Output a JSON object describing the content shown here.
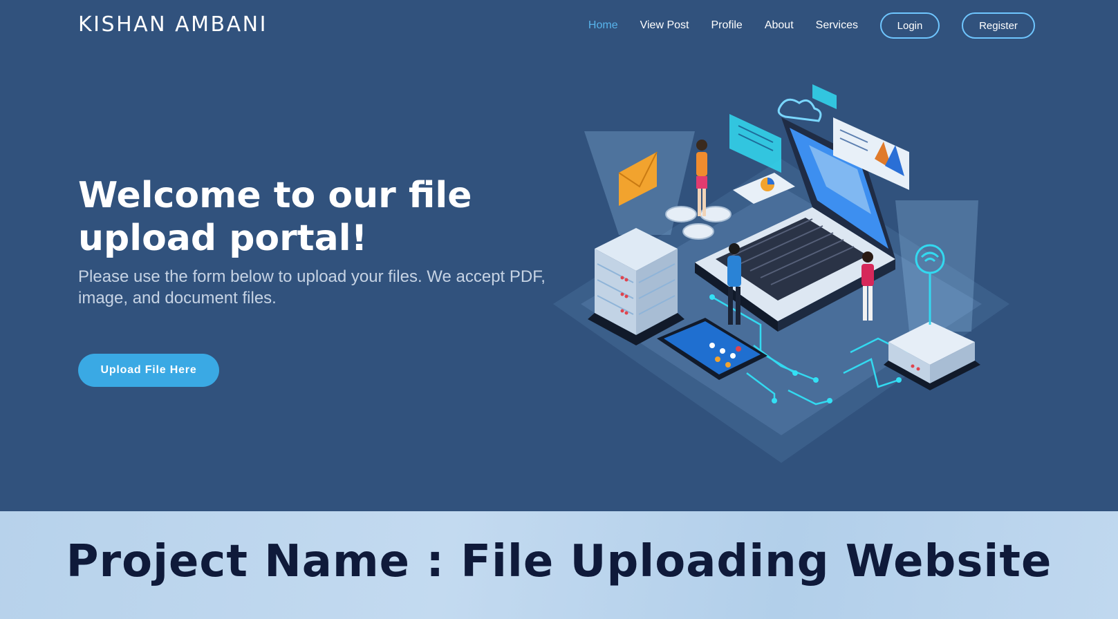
{
  "header": {
    "brand": "KISHAN AMBANI",
    "nav": [
      {
        "label": "Home",
        "active": true
      },
      {
        "label": "View Post",
        "active": false
      },
      {
        "label": "Profile",
        "active": false
      },
      {
        "label": "About",
        "active": false
      },
      {
        "label": "Services",
        "active": false
      }
    ],
    "login_label": "Login",
    "register_label": "Register"
  },
  "hero": {
    "title": "Welcome to our file upload portal!",
    "subtitle": "Please use the form below to upload your files. We accept PDF, image, and document files.",
    "cta_label": "Upload File Here"
  },
  "footer": {
    "project_title": "Project Name : File Uploading Website"
  },
  "colors": {
    "background": "#31527d",
    "accent": "#3aa9e4",
    "active_link": "#58b4ec",
    "footer_text": "#0f1a3a"
  }
}
